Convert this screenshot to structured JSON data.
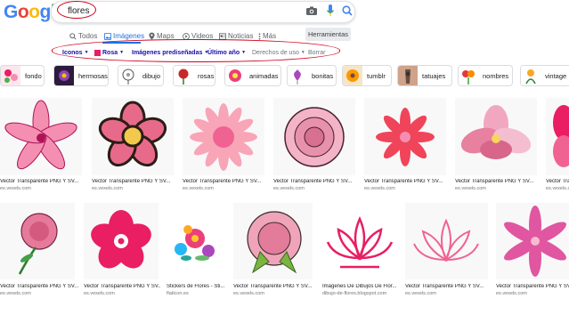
{
  "logo": "Google",
  "search": {
    "query": "flores"
  },
  "tabs": [
    {
      "label": "Todos",
      "icon": "search-icon"
    },
    {
      "label": "Imágenes",
      "icon": "image-icon"
    },
    {
      "label": "Maps",
      "icon": "map-pin-icon"
    },
    {
      "label": "Videos",
      "icon": "video-icon"
    },
    {
      "label": "Noticias",
      "icon": "news-icon"
    },
    {
      "label": "Más",
      "icon": "more-icon"
    }
  ],
  "tools_label": "Herramientas",
  "filters": {
    "icons": "Iconos",
    "color": "Rosa",
    "type": "Imágenes prediseñadas",
    "time": "Último año",
    "rights": "Derechos de uso",
    "clear": "Borrar"
  },
  "chips": [
    "fondo",
    "hermosas",
    "dibujo",
    "rosas",
    "animadas",
    "bonitas",
    "tumblr",
    "tatuajes",
    "nombres",
    "vintage"
  ],
  "results_row1": [
    {
      "title": "Vector Transparente PNG Y SV...",
      "source": "es.vexels.com"
    },
    {
      "title": "Vector Transparente PNG Y SV...",
      "source": "es.vexels.com"
    },
    {
      "title": "Vector Transparente PNG Y SV...",
      "source": "es.vexels.com"
    },
    {
      "title": "Vector Transparente PNG Y SV...",
      "source": "es.vexels.com"
    },
    {
      "title": "Vector Transparente PNG Y SV...",
      "source": "es.vexels.com"
    },
    {
      "title": "Vector Transparente PNG Y SV...",
      "source": "es.vexels.com"
    },
    {
      "title": "Vector Transparente PNG Y SV...",
      "source": "es.vexels.com"
    }
  ],
  "results_row2": [
    {
      "title": "Vector Transparente PNG Y SV...",
      "source": "es.vexels.com"
    },
    {
      "title": "Vector Transparente PNG Y SV...",
      "source": "es.vexels.com"
    },
    {
      "title": "Stickers de Flores - Sti...",
      "source": "flaticon.es"
    },
    {
      "title": "Vector Transparente PNG Y SV...",
      "source": "es.vexels.com"
    },
    {
      "title": "Imágenes De Dibujos De Flor...",
      "source": "dibujo-de-flores.blogspot.com"
    },
    {
      "title": "Vector Transparente PNG Y SV...",
      "source": "es.vexels.com"
    },
    {
      "title": "Vector Transparente PNG Y SV...",
      "source": "es.vexels.com"
    }
  ],
  "colors": {
    "accent": "#1a73e8",
    "annotation": "#d0021b",
    "pink": "#e91e63"
  }
}
